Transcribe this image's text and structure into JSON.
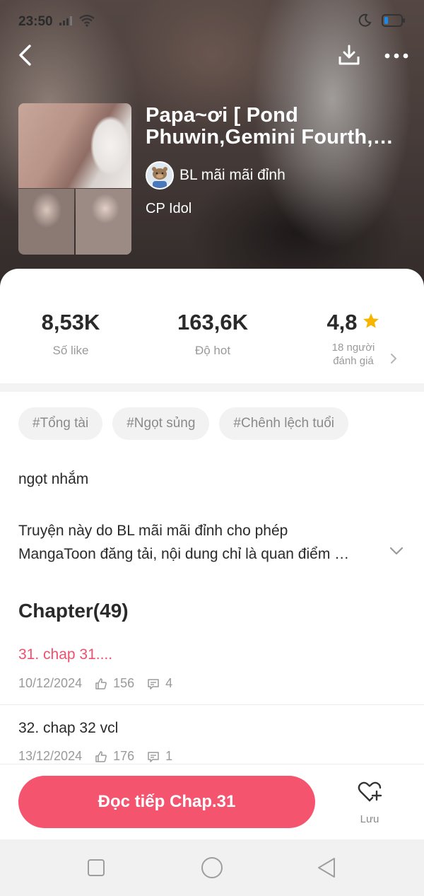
{
  "status_bar": {
    "time": "23:50",
    "icons": [
      "signal-icon",
      "wifi-icon",
      "moon-icon",
      "battery-icon"
    ]
  },
  "topbar": {
    "back_icon": "back-icon",
    "download_icon": "download-icon",
    "more_icon": "more-icon"
  },
  "comic": {
    "title": "Papa~ơi [ Pond Phuwin,Gemini Fourth, Jo…",
    "author": "BL mãi mãi đỉnh",
    "category": "CP Idol"
  },
  "stats": {
    "likes_value": "8,53K",
    "likes_label": "Số like",
    "hot_value": "163,6K",
    "hot_label": "Độ hot",
    "rating_value": "4,8",
    "rating_count_line1": "18 người",
    "rating_count_line2": "đánh giá"
  },
  "tags": [
    "#Tổng tài",
    "#Ngọt sủng",
    "#Chênh lệch tuổi"
  ],
  "summary": "ngọt nhắm",
  "description": {
    "line1": "Truyện này do BL mãi mãi đỉnh cho phép",
    "line2": "MangaToon đăng tải, nội dung chỉ là quan điểm …"
  },
  "chapters_heading": "Chapter(49)",
  "chapters": [
    {
      "title": "31. chap 31....",
      "date": "10/12/2024",
      "likes": "156",
      "comments": "4",
      "current": true
    },
    {
      "title": "32. chap 32 vcl",
      "date": "13/12/2024",
      "likes": "176",
      "comments": "1",
      "current": false
    }
  ],
  "bottom": {
    "read_label": "Đọc tiếp Chap.31",
    "save_label": "Lưu"
  },
  "colors": {
    "accent": "#f5546f",
    "current_chapter": "#f0506e",
    "star": "#f7b500"
  }
}
